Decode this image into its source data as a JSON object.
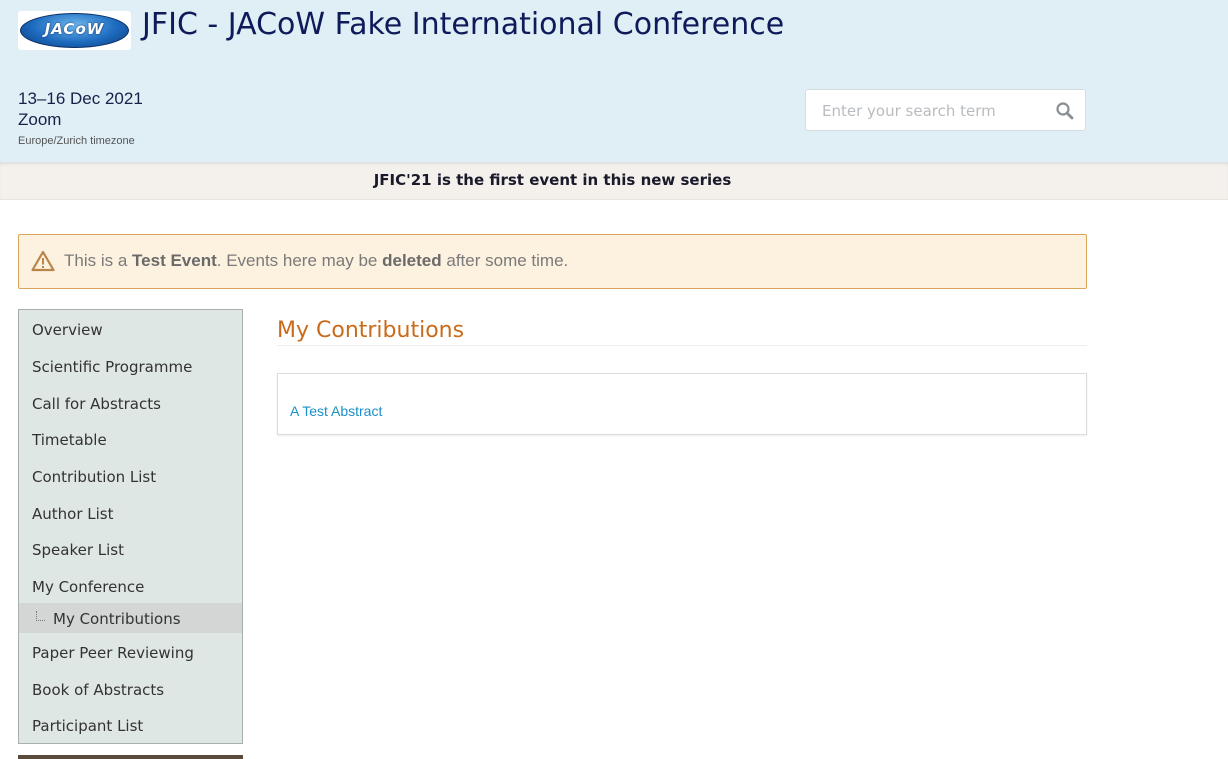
{
  "header": {
    "logo_text": "JACoW",
    "title": "JFIC - JACoW Fake International Conference",
    "dates": "13–16 Dec 2021",
    "location": "Zoom",
    "timezone": "Europe/Zurich timezone",
    "background_color": "#dfeff5"
  },
  "search": {
    "placeholder": "Enter your search term",
    "icon": "search-icon"
  },
  "announcement": {
    "text": "JFIC'21 is the first event in this new series"
  },
  "warning": {
    "icon": "warning-triangle-icon",
    "prefix": "This is a ",
    "bold1": "Test Event",
    "middle": ". Events here may be ",
    "bold2": "deleted",
    "suffix": " after some time."
  },
  "sidebar": {
    "items": [
      {
        "label": "Overview"
      },
      {
        "label": "Scientific Programme"
      },
      {
        "label": "Call for Abstracts"
      },
      {
        "label": "Timetable"
      },
      {
        "label": "Contribution List"
      },
      {
        "label": "Author List"
      },
      {
        "label": "Speaker List"
      },
      {
        "label": "My Conference"
      },
      {
        "label": "My Contributions",
        "sub": true,
        "selected": true
      },
      {
        "label": "Paper Peer Reviewing"
      },
      {
        "label": "Book of Abstracts"
      },
      {
        "label": "Participant List"
      }
    ]
  },
  "main": {
    "title": "My Contributions",
    "title_color": "#c96b1b",
    "contributions": [
      {
        "title": "A Test Abstract"
      }
    ]
  }
}
